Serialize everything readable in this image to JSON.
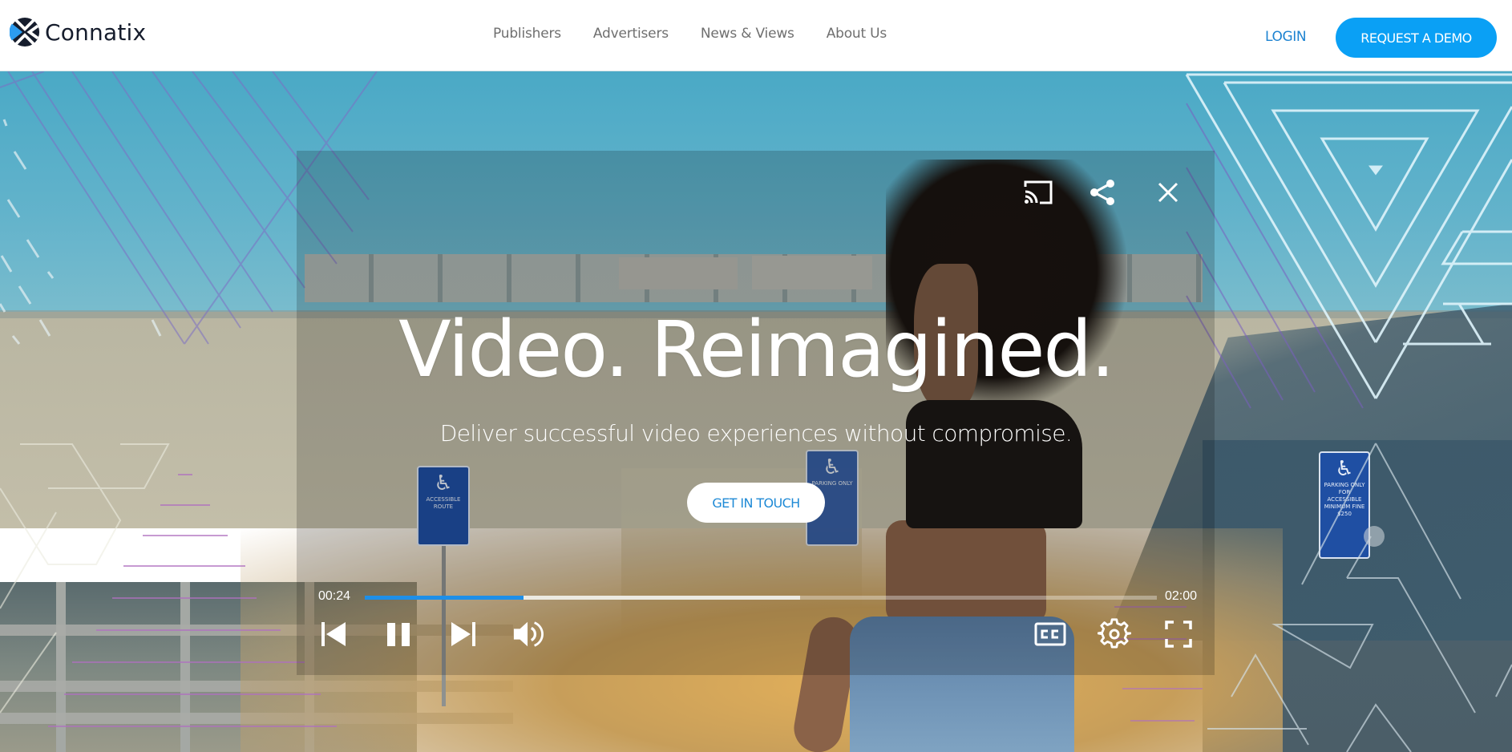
{
  "brand": {
    "name": "Connatix",
    "accent_color": "#0aa0f5",
    "logo_dark": "#161d2d",
    "logo_blue": "#2c9cf0"
  },
  "header": {
    "nav": [
      {
        "label": "Publishers"
      },
      {
        "label": "Advertisers"
      },
      {
        "label": "News & Views"
      },
      {
        "label": "About Us"
      }
    ],
    "login_label": "LOGIN",
    "demo_label": "REQUEST A DEMO"
  },
  "hero": {
    "headline": "Video. Reimagined.",
    "subheadline": "Deliver successful video experiences without compromise.",
    "cta_label": "GET IN TOUCH",
    "signs": [
      {
        "wheel": "♿",
        "text": "ACCESSIBLE ROUTE"
      },
      {
        "wheel": "♿",
        "text": "PARKING ONLY"
      },
      {
        "wheel": "♿",
        "text": "PARKING ONLY FOR ACCESSIBLE MINIMUM FINE $250"
      }
    ]
  },
  "player": {
    "top_controls": [
      {
        "name": "cast",
        "icon": "cast-icon"
      },
      {
        "name": "share",
        "icon": "share-icon"
      },
      {
        "name": "close",
        "icon": "close-icon"
      }
    ],
    "current_time": "00:24",
    "total_time": "02:00",
    "progress_played_percent": 20,
    "progress_buffered_percent": 55,
    "state": "playing",
    "bottom_left_controls": [
      {
        "name": "previous",
        "icon": "skip-previous-icon"
      },
      {
        "name": "pause",
        "icon": "pause-icon"
      },
      {
        "name": "next",
        "icon": "skip-next-icon"
      },
      {
        "name": "volume",
        "icon": "volume-icon"
      }
    ],
    "bottom_right_controls": [
      {
        "name": "captions",
        "icon": "cc-icon"
      },
      {
        "name": "settings",
        "icon": "gear-icon"
      },
      {
        "name": "fullscreen",
        "icon": "fullscreen-icon"
      }
    ],
    "played_color": "#1e8fe8"
  }
}
